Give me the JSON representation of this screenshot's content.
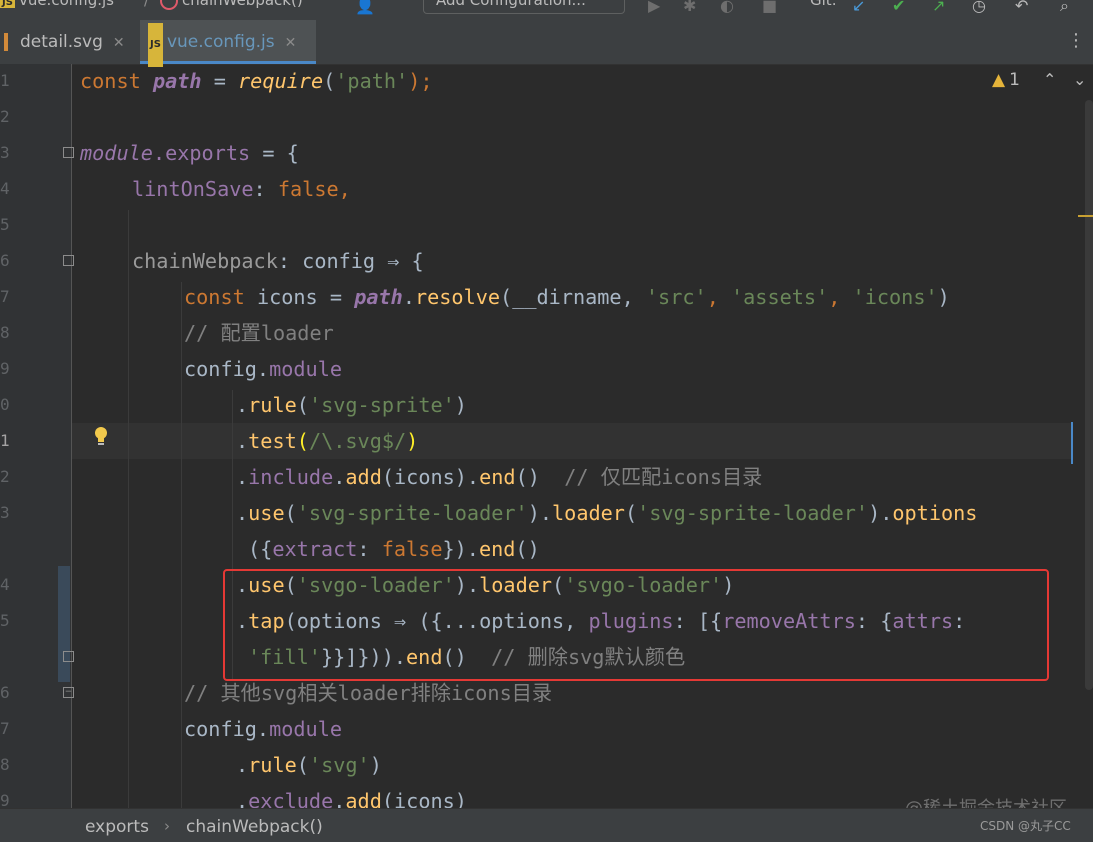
{
  "toolbar": {
    "file_crumb": "vue.config.js",
    "func_crumb": "chainWebpack()",
    "add_config_label": "Add Configuration...",
    "git_label": "Git:"
  },
  "tabs": [
    {
      "label": "detail.svg",
      "active": false
    },
    {
      "label": "vue.config.js",
      "active": true
    }
  ],
  "inspection": {
    "warning_count": "1"
  },
  "line_numbers": [
    "1",
    "2",
    "3",
    "4",
    "5",
    "6",
    "7",
    "8",
    "9",
    "0",
    "1",
    "2",
    "3",
    "",
    "4",
    "5",
    "",
    "6",
    "7",
    "8",
    "9"
  ],
  "code": {
    "l1": [
      "const ",
      "path",
      " = ",
      "require",
      "(",
      "'path'",
      ");"
    ],
    "l3": [
      "module",
      ".exports",
      " = {"
    ],
    "l4": [
      "lintOnSave",
      ": ",
      "false",
      ","
    ],
    "l6": [
      "chainWebpack",
      ": config ⇒ {"
    ],
    "l7": [
      "const ",
      "icons",
      " = ",
      "path",
      ".",
      "resolve",
      "(__dirname, ",
      "'src'",
      ", ",
      "'assets'",
      ", ",
      "'icons'",
      ")"
    ],
    "l8": [
      "// 配置loader"
    ],
    "l9": [
      "config.",
      "module"
    ],
    "l10": [
      ".",
      "rule",
      "(",
      "'svg-sprite'",
      ")"
    ],
    "l11": [
      ".",
      "test",
      "(",
      "/\\.svg$/",
      ")"
    ],
    "l12": [
      ".",
      "include",
      ".",
      "add",
      "(icons).",
      "end",
      "()  ",
      "// 仅匹配icons目录"
    ],
    "l13": [
      ".",
      "use",
      "(",
      "'svg-sprite-loader'",
      ").",
      "loader",
      "(",
      "'svg-sprite-loader'",
      ").",
      "options"
    ],
    "l13b": [
      "({",
      "extract",
      ": ",
      "false",
      "}).",
      "end",
      "()"
    ],
    "l14": [
      ".",
      "use",
      "(",
      "'svgo-loader'",
      ").",
      "loader",
      "(",
      "'svgo-loader'",
      ")"
    ],
    "l15": [
      ".",
      "tap",
      "(options ⇒ ({...options, ",
      "plugins",
      ": [{",
      "removeAttrs",
      ": {",
      "attrs",
      ":"
    ],
    "l15b": [
      "'fill'",
      "}}]})).",
      "end",
      "()  ",
      "// 删除svg默认颜色"
    ],
    "l16": [
      "// 其他svg相关loader排除icons目录"
    ],
    "l17": [
      "config.",
      "module"
    ],
    "l18": [
      ".",
      "rule",
      "(",
      "'svg'",
      ")"
    ],
    "l19": [
      ".",
      "exclude",
      ".",
      "add",
      "(icons)"
    ]
  },
  "status": {
    "crumb1": "exports",
    "crumb2": "chainWebpack()"
  },
  "watermark": "@稀土掘金技术社区",
  "credit": "CSDN @丸子CC",
  "colors": {
    "keyword": "#cc7832",
    "function": "#ffc66d",
    "string": "#6a8759",
    "property": "#9876aa",
    "comment": "#808080",
    "highlight_box": "#e53935"
  }
}
